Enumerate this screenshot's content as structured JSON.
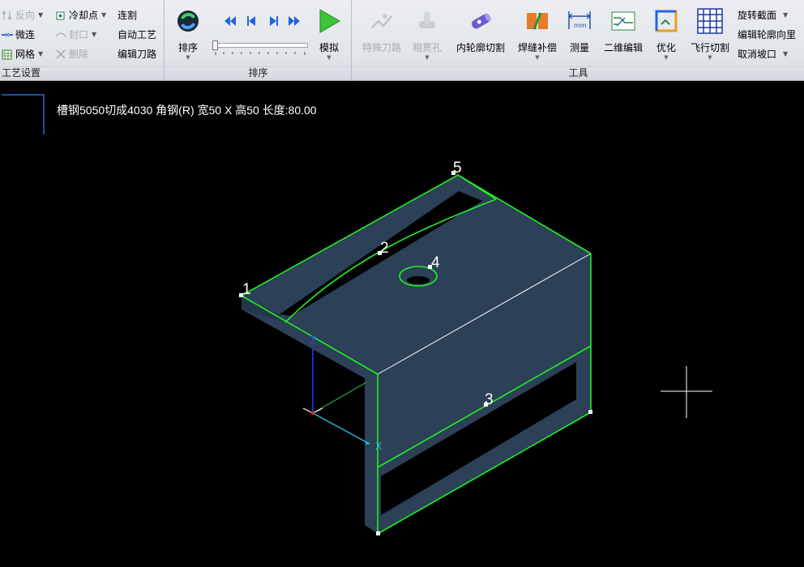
{
  "toolbar": {
    "process_group": {
      "label": "工艺设置",
      "reverse": "反向",
      "cooling_point": "冷却点",
      "link_cut": "连割",
      "micro_join": "微连",
      "seal": "封口",
      "auto_process": "自动工艺",
      "mesh": "网格",
      "delete": "删除",
      "edit_path": "编辑刀路"
    },
    "sort_group": {
      "label": "排序",
      "sort": "排序",
      "simulate": "模拟"
    },
    "tools_group": {
      "label": "工具",
      "special_path": "特殊刀路",
      "intersect_hole": "相贯孔",
      "inner_contour_cut": "内轮廓切割",
      "weld_compensation": "焊缝补偿",
      "measure": "测量",
      "edit_2d": "二维编辑",
      "optimize": "优化",
      "fly_cut": "飞行切割",
      "rotate_section": "旋转截面",
      "edit_contour_direction": "编辑轮廓向里",
      "cancel_bevel": "取消坡口"
    }
  },
  "canvas": {
    "caption": "槽钢5050切成4030 角钢(R) 宽50 X 高50 长度:80.00",
    "point_labels": [
      "1",
      "2",
      "3",
      "4",
      "5"
    ],
    "axis_labels": {
      "z": "Z",
      "x": "X"
    },
    "colors": {
      "background": "#000000",
      "part_fill": "#2c4057",
      "outline": "#22ee22",
      "edge": "#ffffff"
    }
  }
}
